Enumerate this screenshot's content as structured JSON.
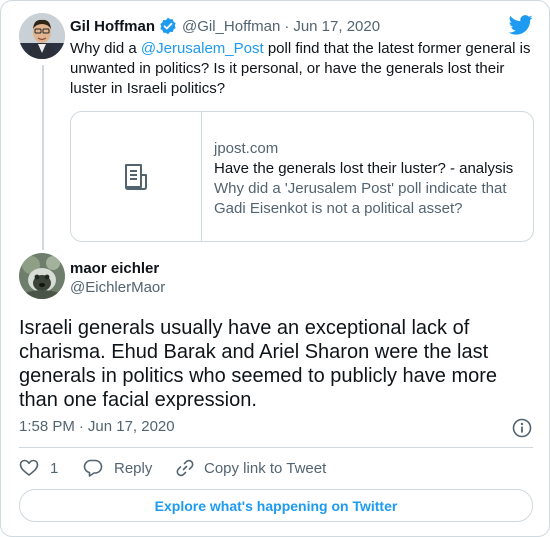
{
  "reply_to": {
    "name": "Gil Hoffman",
    "handle": "@Gil_Hoffman",
    "separator": "·",
    "date": "Jun 17, 2020",
    "text_before": "Why did a ",
    "mention": "@Jerusalem_Post",
    "text_after": " poll find that the latest former general is unwanted in politics? Is it personal, or have the generals lost their luster in Israeli politics?"
  },
  "link_card": {
    "domain": "jpost.com",
    "title": "Have the generals lost their luster? - analysis",
    "description": "Why did a 'Jerusalem Post' poll indicate that Gadi Eisenkot is not a political asset?",
    "icon": "document-icon"
  },
  "tweet": {
    "name": "maor eichler",
    "handle": "@EichlerMaor",
    "text": "Israeli generals usually have an exceptional lack of charisma. Ehud Barak and Ariel Sharon were the last generals in politics who seemed to publicly have more than one facial expression.",
    "time": "1:58 PM",
    "separator": "·",
    "date": "Jun 17, 2020"
  },
  "actions": {
    "like_count": "1",
    "reply_label": "Reply",
    "copy_link_label": "Copy link to Tweet"
  },
  "footer": {
    "explore_label": "Explore what's happening on Twitter"
  },
  "colors": {
    "accent": "#1d9bf0",
    "text": "#0f1419",
    "muted": "#536471",
    "border": "#cfd9de"
  }
}
